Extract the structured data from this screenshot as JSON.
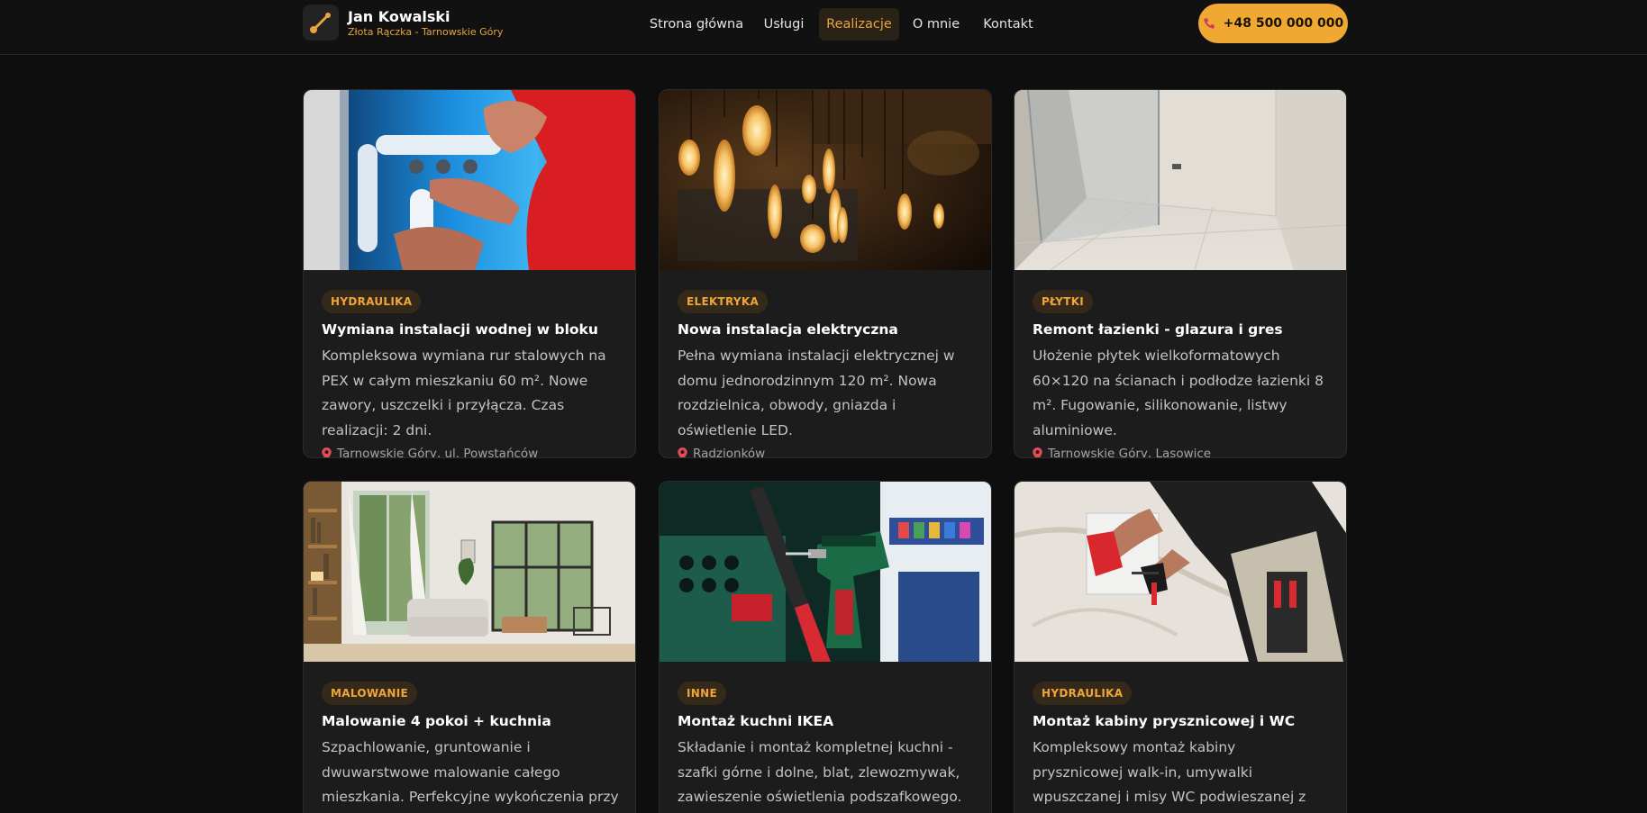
{
  "header": {
    "brand_name": "Jan Kowalski",
    "brand_sub": "Złota Rączka - Tarnowskie Góry",
    "logo_icon": "wrench-icon",
    "nav": [
      {
        "label": "Strona główna",
        "active": false
      },
      {
        "label": "Usługi",
        "active": false
      },
      {
        "label": "Realizacje",
        "active": true
      },
      {
        "label": "O mnie",
        "active": false
      },
      {
        "label": "Kontakt",
        "active": false
      }
    ],
    "phone": "+48 500 000 000",
    "phone_icon": "phone-icon"
  },
  "colors": {
    "accent": "#efa932",
    "background": "#0e0e0e",
    "card": "#1c1c1c",
    "tag_bg": "#35291a",
    "tag_text": "#efa53a"
  },
  "cards": [
    {
      "category": "HYDRAULIKA",
      "title": "Wymiana instalacji wodnej w bloku",
      "desc": "Kompleksowa wymiana rur stalowych na PEX w całym mieszkaniu 60 m². Nowe zawory, uszczelki i przyłącza. Czas realizacji: 2 dni.",
      "location": "Tarnowskie Góry, ul. Powstańców",
      "location_icon": "pin-icon"
    },
    {
      "category": "ELEKTRYKA",
      "title": "Nowa instalacja elektryczna",
      "desc": "Pełna wymiana instalacji elektrycznej w domu jednorodzinnym 120 m². Nowa rozdzielnica, obwody, gniazda i oświetlenie LED.",
      "location": "Radzionków",
      "location_icon": "pin-icon"
    },
    {
      "category": "PŁYTKI",
      "title": "Remont łazienki - glazura i gres",
      "desc": "Ułożenie płytek wielkoformatowych 60×120 na ścianach i podłodze łazienki 8 m². Fugowanie, silikonowanie, listwy aluminiowe.",
      "location": "Tarnowskie Góry, Lasowice",
      "location_icon": "pin-icon"
    },
    {
      "category": "MALOWANIE",
      "title": "Malowanie 4 pokoi + kuchnia",
      "desc": "Szpachlowanie, gruntowanie i dwuwarstwowe malowanie całego mieszkania. Perfekcyjne wykończenia przy oknach i listwach."
    },
    {
      "category": "INNE",
      "title": "Montaż kuchni IKEA",
      "desc": "Składanie i montaż kompletnej kuchni - szafki górne i dolne, blat, zlewozmywak, zawieszenie oświetlenia podszafkowego."
    },
    {
      "category": "HYDRAULIKA",
      "title": "Montaż kabiny prysznicowej i WC",
      "desc": "Kompleksowy montaż kabiny prysznicowej walk-in, umywalki wpuszczanej i misy WC podwieszanej z stelażem."
    }
  ]
}
